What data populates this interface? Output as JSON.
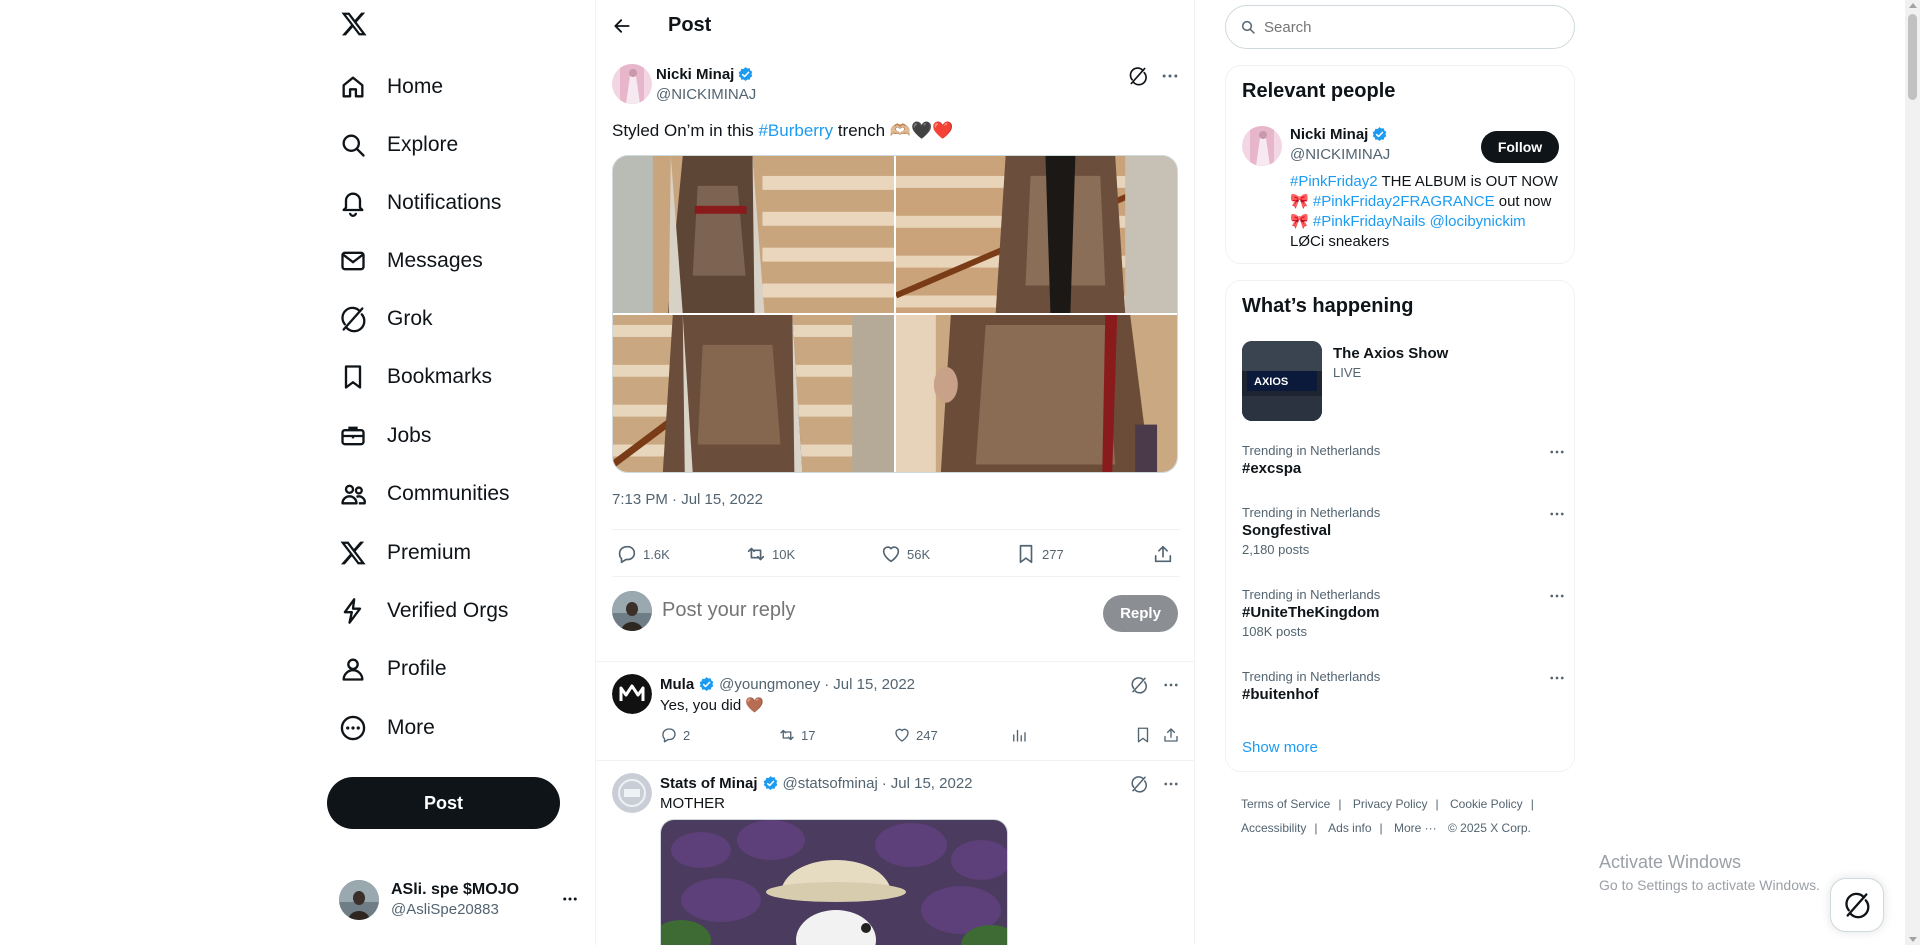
{
  "nav": {
    "logo_icon": "x-logo-icon",
    "items": [
      {
        "label": "Home",
        "icon": "home-icon"
      },
      {
        "label": "Explore",
        "icon": "search-icon"
      },
      {
        "label": "Notifications",
        "icon": "bell-icon"
      },
      {
        "label": "Messages",
        "icon": "mail-icon"
      },
      {
        "label": "Grok",
        "icon": "grok-icon"
      },
      {
        "label": "Bookmarks",
        "icon": "bookmark-icon"
      },
      {
        "label": "Jobs",
        "icon": "briefcase-icon"
      },
      {
        "label": "Communities",
        "icon": "people-icon"
      },
      {
        "label": "Premium",
        "icon": "x-logo-icon"
      },
      {
        "label": "Verified Orgs",
        "icon": "lightning-icon"
      },
      {
        "label": "Profile",
        "icon": "person-icon"
      },
      {
        "label": "More",
        "icon": "more-circle-icon"
      }
    ],
    "post_button": "Post",
    "account": {
      "name": "ASli. spe $MOJO",
      "handle": "@AsliSpe20883"
    }
  },
  "header": {
    "title": "Post"
  },
  "tweet": {
    "author_name": "Nicki Minaj",
    "author_handle": "@NICKIMINAJ",
    "text_before": "Styled On’m in this ",
    "hashtag": "#Burberry",
    "text_after": " trench 🫶🏼🖤❤️",
    "time": "7:13 PM · Jul 15, 2022",
    "stats": {
      "replies": "1.6K",
      "reposts": "10K",
      "likes": "56K",
      "bookmarks": "277"
    }
  },
  "reply_box": {
    "placeholder": "Post your reply",
    "button": "Reply"
  },
  "replies": [
    {
      "name": "Mula",
      "handle": "@youngmoney",
      "date": "Jul 15, 2022",
      "text": "Yes, you did 🤎",
      "replies": "2",
      "reposts": "17",
      "likes": "247"
    },
    {
      "name": "Stats of Minaj",
      "handle": "@statsofminaj",
      "date": "Jul 15, 2022",
      "text": "MOTHER"
    }
  ],
  "right": {
    "search_placeholder": "Search",
    "relevant": {
      "title": "Relevant people",
      "name": "Nicki Minaj",
      "handle": "@NICKIMINAJ",
      "follow": "Follow",
      "bio": {
        "l1_tag": "#PinkFriday2",
        "l1_text": " THE ALBUM is OUT NOW",
        "l2_bow": "🎀",
        "l2_tag": "#PinkFriday2FRAGRANCE",
        "l2_text": " out now",
        "l3_bow": "🎀",
        "l3_tag": "#PinkFridayNails",
        "l3_mention": "@locibynickim",
        "l4_text": "LØCi sneakers"
      }
    },
    "happening": {
      "title": "What’s happening",
      "event": {
        "title": "The Axios Show",
        "status": "LIVE",
        "thumb_text": "AXIOS"
      },
      "trends": [
        {
          "context": "Trending in Netherlands",
          "name": "#excspa",
          "posts": ""
        },
        {
          "context": "Trending in Netherlands",
          "name": "Songfestival",
          "posts": "2,180 posts"
        },
        {
          "context": "Trending in Netherlands",
          "name": "#UniteTheKingdom",
          "posts": "108K posts"
        },
        {
          "context": "Trending in Netherlands",
          "name": "#buitenhof",
          "posts": ""
        }
      ],
      "show_more": "Show more"
    },
    "footer": [
      "Terms of Service",
      "Privacy Policy",
      "Cookie Policy",
      "Accessibility",
      "Ads info",
      "More ···",
      "© 2025 X Corp."
    ]
  },
  "os_overlay": {
    "line1": "Activate Windows",
    "line2": "Go to Settings to activate Windows."
  },
  "colors": {
    "accent": "#1d9bf0",
    "text": "#0f1419",
    "muted": "#536471",
    "border": "#eff3f4"
  }
}
